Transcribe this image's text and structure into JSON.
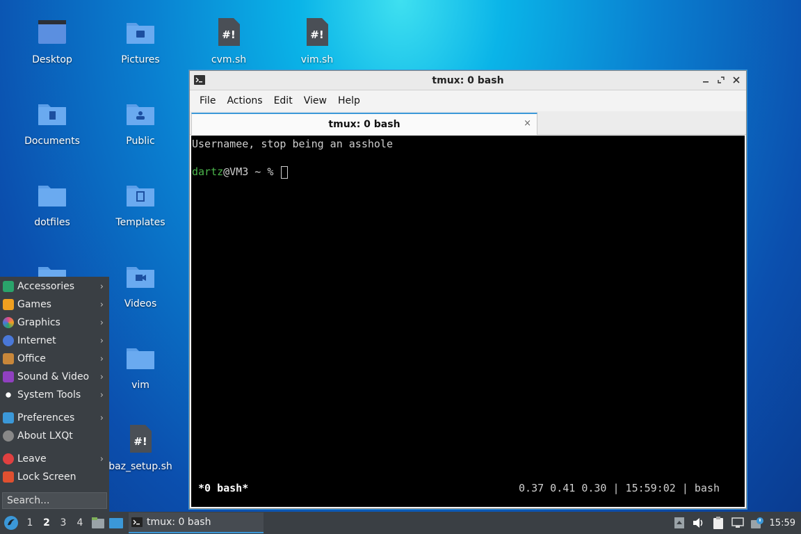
{
  "desktop": {
    "icons": [
      {
        "label": "Desktop",
        "kind": "desktop-folder"
      },
      {
        "label": "Pictures",
        "kind": "pictures-folder"
      },
      {
        "label": "cvm.sh",
        "kind": "script-file"
      },
      {
        "label": "vim.sh",
        "kind": "script-file"
      },
      {
        "label": "Documents",
        "kind": "documents-folder"
      },
      {
        "label": "Public",
        "kind": "public-folder"
      },
      {
        "label": "dotfiles",
        "kind": "folder"
      },
      {
        "label": "Templates",
        "kind": "templates-folder"
      },
      {
        "label": "Videos",
        "kind": "videos-folder"
      },
      {
        "label": "vim",
        "kind": "folder"
      },
      {
        "label": "baz_setup.sh",
        "kind": "script-file"
      }
    ]
  },
  "window": {
    "title": "tmux: 0 bash",
    "menu": [
      "File",
      "Actions",
      "Edit",
      "View",
      "Help"
    ],
    "tab_label": "tmux: 0 bash",
    "tab_close": "×",
    "terminal": {
      "line1": "Usernamee, stop being an asshole",
      "prompt_user": "dartz",
      "prompt_rest": "@VM3 ~ % ",
      "status_left": "*0 bash*",
      "status_right": "0.37 0.41 0.30 | 15:59:02 | bash"
    }
  },
  "appmenu": {
    "items": [
      {
        "label": "Accessories",
        "icon": "accessories-icon",
        "color": "#2aa36b",
        "submenu": true
      },
      {
        "label": "Games",
        "icon": "games-icon",
        "color": "#f0a020",
        "submenu": true
      },
      {
        "label": "Graphics",
        "icon": "graphics-icon",
        "color": "#e04a8a",
        "submenu": true
      },
      {
        "label": "Internet",
        "icon": "internet-icon",
        "color": "#4a78d8",
        "submenu": true
      },
      {
        "label": "Office",
        "icon": "office-icon",
        "color": "#c8873a",
        "submenu": true
      },
      {
        "label": "Sound & Video",
        "icon": "sound-video-icon",
        "color": "#9040c0",
        "submenu": true
      },
      {
        "label": "System Tools",
        "icon": "system-tools-icon",
        "color": "#dddddd",
        "submenu": true
      },
      {
        "label": "Preferences",
        "icon": "preferences-icon",
        "color": "#3b98d8",
        "submenu": true
      },
      {
        "label": "About LXQt",
        "icon": "about-icon",
        "color": "#888888",
        "submenu": false
      },
      {
        "label": "Leave",
        "icon": "leave-icon",
        "color": "#e04040",
        "submenu": true
      },
      {
        "label": "Lock Screen",
        "icon": "lock-icon",
        "color": "#e05030",
        "submenu": false
      }
    ],
    "search_placeholder": "Search..."
  },
  "taskbar": {
    "desktops": [
      "1",
      "2",
      "3",
      "4"
    ],
    "active_desktop": "2",
    "task_label": "tmux: 0 bash",
    "clock": "15:59"
  },
  "colors": {
    "accent": "#3b98d8",
    "prompt_green": "#4bb44b",
    "panel": "#3a3f44"
  }
}
